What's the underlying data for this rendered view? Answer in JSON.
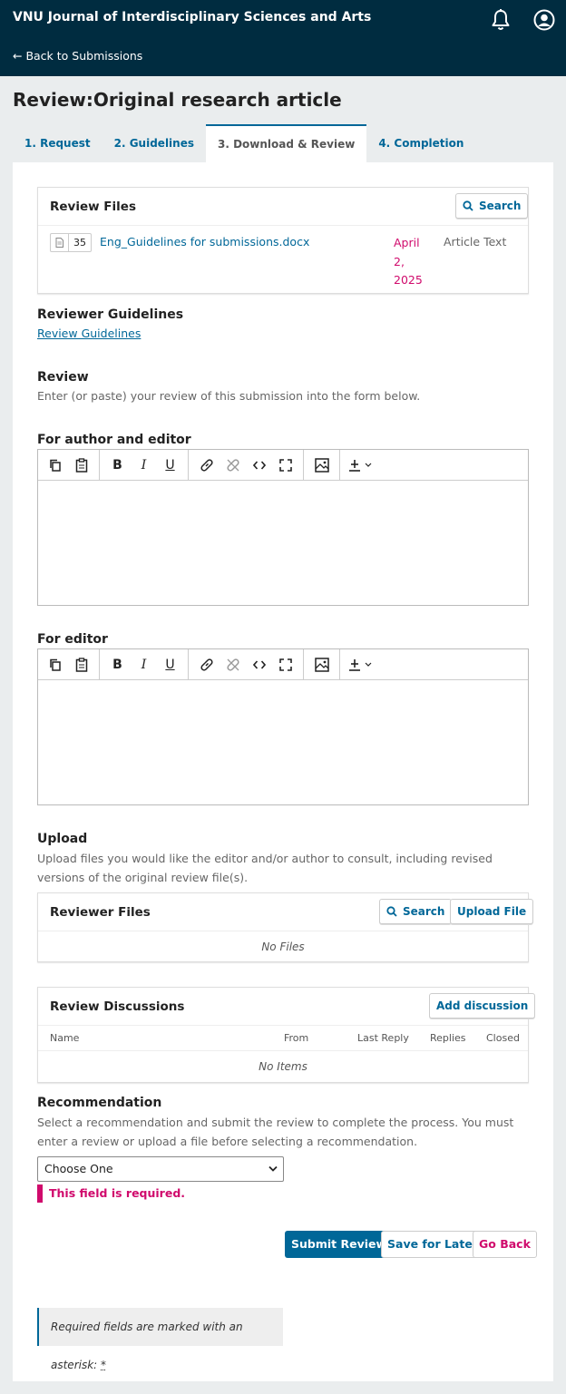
{
  "header": {
    "site_title": "VNU Journal of Interdisciplinary Sciences and Arts",
    "back_link": "← Back to Submissions",
    "icons": [
      "bell-icon",
      "user-icon"
    ]
  },
  "page_title": "Review:Original research article",
  "tabs": [
    {
      "label": "1. Request"
    },
    {
      "label": "2. Guidelines"
    },
    {
      "label": "3. Download & Review",
      "active": true
    },
    {
      "label": "4. Completion"
    }
  ],
  "review_files": {
    "title": "Review Files",
    "search_label": "Search",
    "file": {
      "id": "35",
      "name": "Eng_Guidelines for submissions.docx",
      "date_lines": [
        "April",
        "2,",
        "2025"
      ],
      "type": "Article Text"
    }
  },
  "guidelines": {
    "label": "Reviewer Guidelines",
    "link": "Review Guidelines"
  },
  "review": {
    "label": "Review",
    "description": "Enter (or paste) your review of this submission into the form below."
  },
  "editors": {
    "author_editor_label": "For author and editor",
    "editor_label": "For editor"
  },
  "upload": {
    "label": "Upload",
    "description": "Upload files you would like the editor and/or author to consult, including revised versions of the original review file(s)."
  },
  "reviewer_files": {
    "title": "Reviewer Files",
    "search_label": "Search",
    "upload_label": "Upload File",
    "empty": "No Files"
  },
  "discussions": {
    "title": "Review Discussions",
    "add_label": "Add discussion",
    "columns": [
      "Name",
      "From",
      "Last Reply",
      "Replies",
      "Closed"
    ],
    "empty": "No Items"
  },
  "recommendation": {
    "label": "Recommendation",
    "description": "Select a recommendation and submit the review to complete the process. You must enter a review or upload a file before selecting a recommendation.",
    "selected": "Choose One",
    "error": "This field is required."
  },
  "actions": {
    "submit": "Submit Review",
    "save": "Save for Later",
    "back": "Go Back"
  },
  "footer_note": {
    "text": "Required fields are marked with an asterisk: ",
    "asterisk": "*"
  },
  "colors": {
    "header_bg": "#002c40",
    "primary": "#006798",
    "error": "#d00a6c"
  }
}
